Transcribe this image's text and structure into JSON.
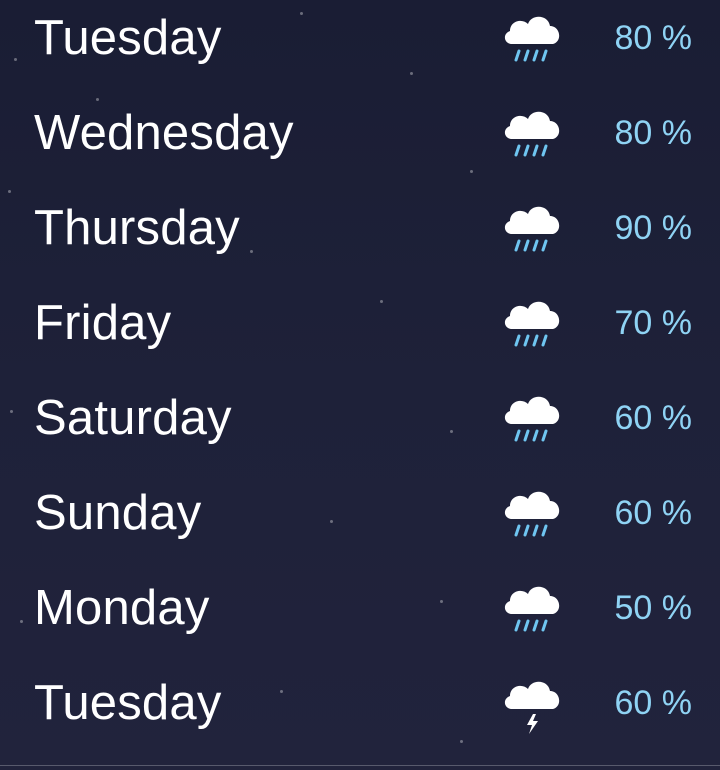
{
  "forecast": {
    "days": [
      {
        "day": "Tuesday",
        "chance": "80 %",
        "icon": "cloud-rain-icon"
      },
      {
        "day": "Wednesday",
        "chance": "80 %",
        "icon": "cloud-rain-icon"
      },
      {
        "day": "Thursday",
        "chance": "90 %",
        "icon": "cloud-rain-icon"
      },
      {
        "day": "Friday",
        "chance": "70 %",
        "icon": "cloud-rain-icon"
      },
      {
        "day": "Saturday",
        "chance": "60 %",
        "icon": "cloud-rain-icon"
      },
      {
        "day": "Sunday",
        "chance": "60 %",
        "icon": "cloud-rain-icon"
      },
      {
        "day": "Monday",
        "chance": "50 %",
        "icon": "cloud-rain-icon"
      },
      {
        "day": "Tuesday",
        "chance": "60 %",
        "icon": "cloud-lightning-icon"
      }
    ]
  },
  "colors": {
    "background": "#1d2038",
    "day_text": "#ffffff",
    "chance_text": "#8fd3f4",
    "rain_streak": "#6fc5f0",
    "bolt": "#ffffff"
  }
}
